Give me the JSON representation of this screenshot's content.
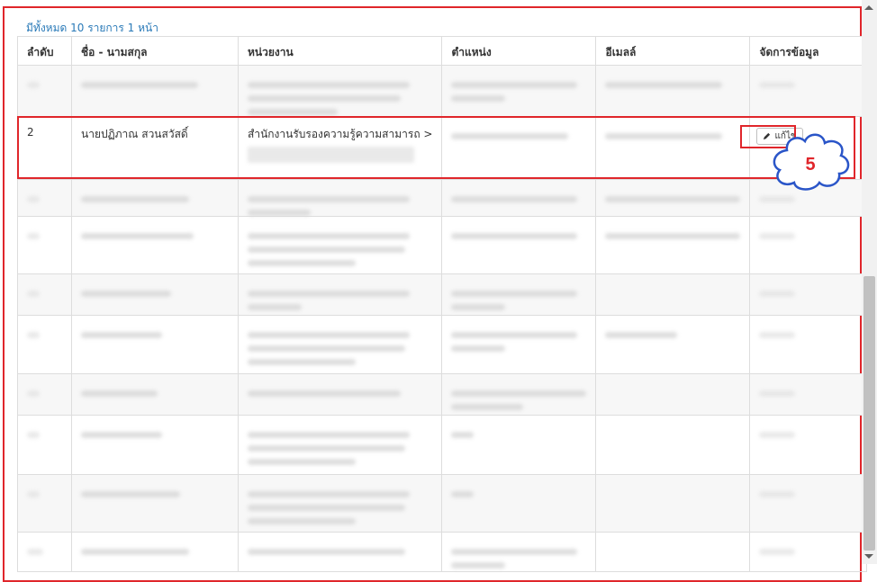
{
  "summary": "มีทั้งหมด 10 รายการ 1 หน้า",
  "headers": [
    "ลำดับ",
    "ชื่อ - นามสกุล",
    "หน่วยงาน",
    "ตำแหน่ง",
    "อีเมลล์",
    "จัดการข้อมูล"
  ],
  "highlighted_row": {
    "order": "2",
    "name": "นายปฏิภาณ สวนสวัสดิ์",
    "department": "สำนักงานรับรองความรู้ความสามารถ >",
    "edit_label": "แก้ไข"
  },
  "callout_number": "5",
  "colors": {
    "highlight": "#e0262b",
    "link": "#2a7ab8",
    "callout_text": "#e0262b"
  },
  "icons": [
    "pencil-icon",
    "scroll-up-icon",
    "scroll-down-icon"
  ]
}
